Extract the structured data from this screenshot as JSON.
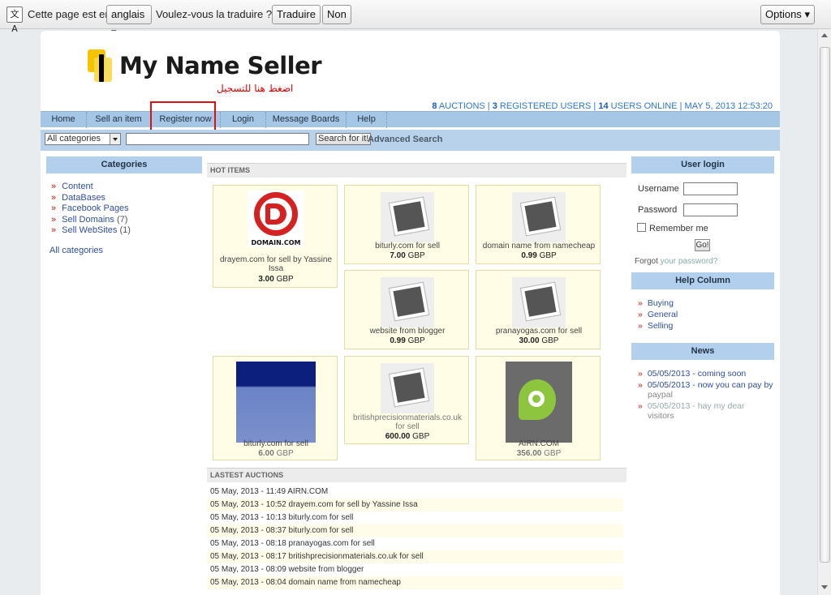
{
  "translate_bar": {
    "icon": "translate-icon",
    "prefix": "Cette page est en",
    "language": "anglais",
    "question": "Voulez-vous la traduire ?",
    "translate_btn": "Traduire",
    "no_btn": "Non",
    "options_btn": "Options"
  },
  "site": {
    "logo_text": "My Name Seller",
    "arabic_caption": "اضغط هنا للتسجيل",
    "stats": {
      "auctions_n": "8",
      "auctions_label": " AUCTIONS | ",
      "users_n": "3",
      "users_label": " REGISTERED USERS | ",
      "online_n": "14",
      "online_label": " USERS ONLINE | ",
      "datetime": "MAY 5, 2013 12:53:20"
    }
  },
  "nav": [
    "Home",
    "Sell an item",
    "Register now",
    "Login",
    "Message Boards",
    "Help"
  ],
  "search": {
    "category": "All categories",
    "value": "",
    "button": "Search for it!",
    "advanced": "Advanced Search"
  },
  "categories": {
    "title": "Categories",
    "items": [
      {
        "label": "Content",
        "count": ""
      },
      {
        "label": "DataBases",
        "count": ""
      },
      {
        "label": "Facebook Pages",
        "count": ""
      },
      {
        "label": "Sell Domains",
        "count": " (7)"
      },
      {
        "label": "Sell WebSites",
        "count": " (1)"
      }
    ],
    "all": "All categories"
  },
  "hot_items": {
    "title": "HOT ITEMS",
    "items": [
      {
        "title": "drayem.com for sell by Yassine Issa",
        "price": "3.00",
        "currency": "GBP",
        "image": "domain-logo"
      },
      {
        "title": "biturly.com for sell",
        "price": "7.00",
        "currency": "GBP",
        "image": "placeholder"
      },
      {
        "title": "domain name from namecheap",
        "price": "0.99",
        "currency": "GBP",
        "image": "placeholder"
      },
      {
        "title": "website from blogger",
        "price": "0.99",
        "currency": "GBP",
        "image": "placeholder"
      },
      {
        "title": "pranayogas.com for sell",
        "price": "30.00",
        "currency": "GBP",
        "image": "placeholder"
      },
      {
        "title": "biturly.com for sell",
        "price": "6.00",
        "currency": "GBP",
        "image": "blue-banner"
      },
      {
        "title": "britishprecisionmaterials.co.uk for sell",
        "price": "600.00",
        "currency": "GBP",
        "image": "placeholder"
      },
      {
        "title": "AIRN.COM",
        "price": "356.00",
        "currency": "GBP",
        "image": "airn-logo"
      }
    ]
  },
  "latest": {
    "title": "LASTEST AUCTIONS",
    "items": [
      "05 May, 2013 - 11:49 AIRN.COM",
      "05 May, 2013 - 10:52 drayem.com for sell by Yassine Issa",
      "05 May, 2013 - 10:13 biturly.com for sell",
      "05 May, 2013 - 08:37 biturly.com for sell",
      "05 May, 2013 - 08:18 pranayogas.com for sell",
      "05 May, 2013 - 08:17 britishprecisionmaterials.co.uk for sell",
      "05 May, 2013 - 08:09 website from blogger",
      "05 May, 2013 - 08:04 domain name from namecheap"
    ]
  },
  "login": {
    "title": "User login",
    "username_label": "Username",
    "password_label": "Password",
    "remember": "Remember me",
    "go": "Go!",
    "forgot_a": "Forgot",
    "forgot_b": " your password?"
  },
  "help": {
    "title": "Help Column",
    "items": [
      "Buying",
      "General",
      "Selling"
    ]
  },
  "news": {
    "title": "News",
    "items": [
      {
        "text": "05/05/2013 - coming soon",
        "sub": ""
      },
      {
        "text": "05/05/2013 - now you can pay by",
        "sub": "paypal"
      },
      {
        "text": "05/05/2013 - hay my dear",
        "sub": "visitors"
      }
    ]
  }
}
